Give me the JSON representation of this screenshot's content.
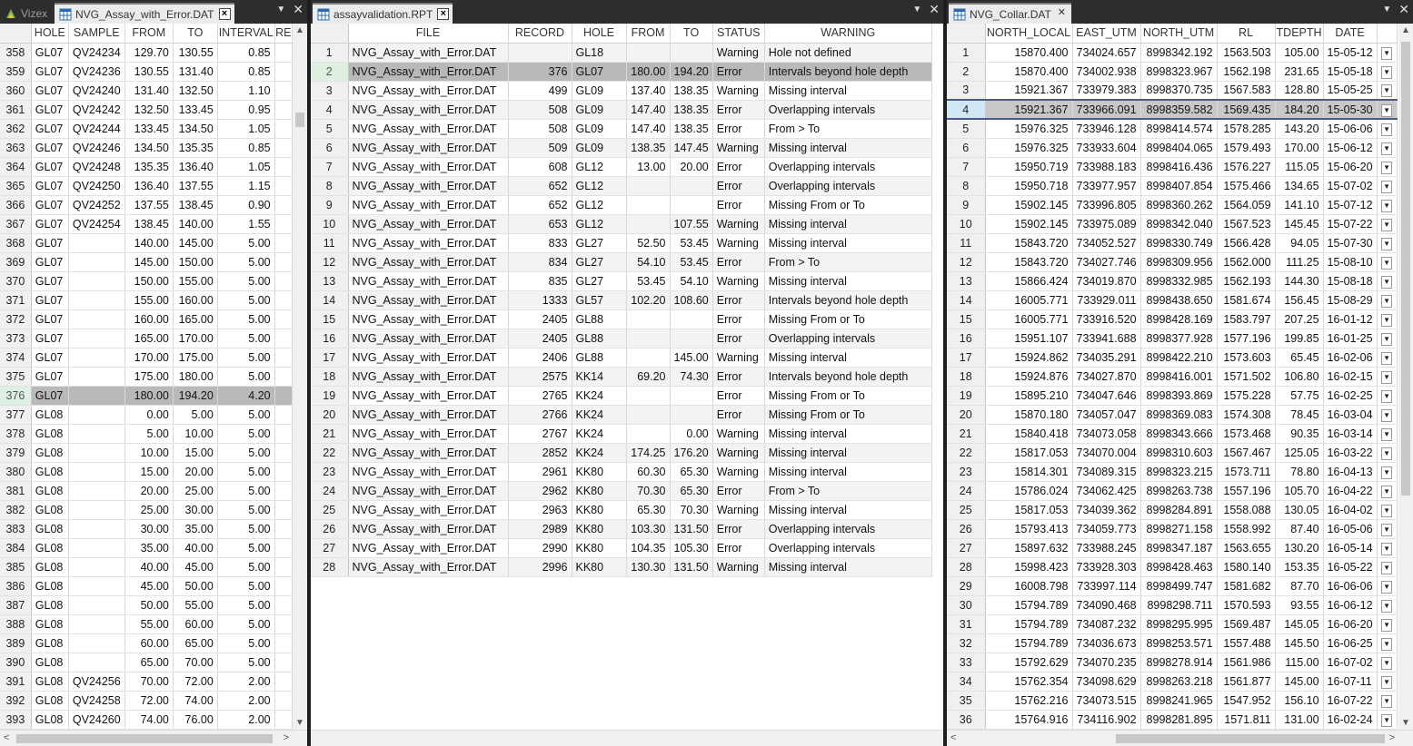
{
  "pane1": {
    "inactive_tab": "Vizex",
    "active_tab": "NVG_Assay_with_Error.DAT",
    "columns": [
      "HOLE",
      "SAMPLE",
      "FROM",
      "TO",
      "INTERVAL",
      "RE"
    ],
    "rows": [
      [
        "358",
        "GL07",
        "QV24234",
        "129.70",
        "130.55",
        "0.85"
      ],
      [
        "359",
        "GL07",
        "QV24236",
        "130.55",
        "131.40",
        "0.85"
      ],
      [
        "360",
        "GL07",
        "QV24240",
        "131.40",
        "132.50",
        "1.10"
      ],
      [
        "361",
        "GL07",
        "QV24242",
        "132.50",
        "133.45",
        "0.95"
      ],
      [
        "362",
        "GL07",
        "QV24244",
        "133.45",
        "134.50",
        "1.05"
      ],
      [
        "363",
        "GL07",
        "QV24246",
        "134.50",
        "135.35",
        "0.85"
      ],
      [
        "364",
        "GL07",
        "QV24248",
        "135.35",
        "136.40",
        "1.05"
      ],
      [
        "365",
        "GL07",
        "QV24250",
        "136.40",
        "137.55",
        "1.15"
      ],
      [
        "366",
        "GL07",
        "QV24252",
        "137.55",
        "138.45",
        "0.90"
      ],
      [
        "367",
        "GL07",
        "QV24254",
        "138.45",
        "140.00",
        "1.55"
      ],
      [
        "368",
        "GL07",
        "",
        "140.00",
        "145.00",
        "5.00"
      ],
      [
        "369",
        "GL07",
        "",
        "145.00",
        "150.00",
        "5.00"
      ],
      [
        "370",
        "GL07",
        "",
        "150.00",
        "155.00",
        "5.00"
      ],
      [
        "371",
        "GL07",
        "",
        "155.00",
        "160.00",
        "5.00"
      ],
      [
        "372",
        "GL07",
        "",
        "160.00",
        "165.00",
        "5.00"
      ],
      [
        "373",
        "GL07",
        "",
        "165.00",
        "170.00",
        "5.00"
      ],
      [
        "374",
        "GL07",
        "",
        "170.00",
        "175.00",
        "5.00"
      ],
      [
        "375",
        "GL07",
        "",
        "175.00",
        "180.00",
        "5.00"
      ],
      [
        "376",
        "GL07",
        "",
        "180.00",
        "194.20",
        "4.20"
      ],
      [
        "377",
        "GL08",
        "",
        "0.00",
        "5.00",
        "5.00"
      ],
      [
        "378",
        "GL08",
        "",
        "5.00",
        "10.00",
        "5.00"
      ],
      [
        "379",
        "GL08",
        "",
        "10.00",
        "15.00",
        "5.00"
      ],
      [
        "380",
        "GL08",
        "",
        "15.00",
        "20.00",
        "5.00"
      ],
      [
        "381",
        "GL08",
        "",
        "20.00",
        "25.00",
        "5.00"
      ],
      [
        "382",
        "GL08",
        "",
        "25.00",
        "30.00",
        "5.00"
      ],
      [
        "383",
        "GL08",
        "",
        "30.00",
        "35.00",
        "5.00"
      ],
      [
        "384",
        "GL08",
        "",
        "35.00",
        "40.00",
        "5.00"
      ],
      [
        "385",
        "GL08",
        "",
        "40.00",
        "45.00",
        "5.00"
      ],
      [
        "386",
        "GL08",
        "",
        "45.00",
        "50.00",
        "5.00"
      ],
      [
        "387",
        "GL08",
        "",
        "50.00",
        "55.00",
        "5.00"
      ],
      [
        "388",
        "GL08",
        "",
        "55.00",
        "60.00",
        "5.00"
      ],
      [
        "389",
        "GL08",
        "",
        "60.00",
        "65.00",
        "5.00"
      ],
      [
        "390",
        "GL08",
        "",
        "65.00",
        "70.00",
        "5.00"
      ],
      [
        "391",
        "GL08",
        "QV24256",
        "70.00",
        "72.00",
        "2.00"
      ],
      [
        "392",
        "GL08",
        "QV24258",
        "72.00",
        "74.00",
        "2.00"
      ],
      [
        "393",
        "GL08",
        "QV24260",
        "74.00",
        "76.00",
        "2.00"
      ]
    ],
    "selected_row": "376"
  },
  "pane2": {
    "active_tab": "assayvalidation.RPT",
    "columns": [
      "FILE",
      "RECORD",
      "HOLE",
      "FROM",
      "TO",
      "STATUS",
      "WARNING"
    ],
    "rows": [
      [
        "1",
        "NVG_Assay_with_Error.DAT",
        "",
        "GL18",
        "",
        "",
        "Warning",
        "Hole not defined"
      ],
      [
        "2",
        "NVG_Assay_with_Error.DAT",
        "376",
        "GL07",
        "180.00",
        "194.20",
        "Error",
        "Intervals beyond hole depth"
      ],
      [
        "3",
        "NVG_Assay_with_Error.DAT",
        "499",
        "GL09",
        "137.40",
        "138.35",
        "Warning",
        "Missing interval"
      ],
      [
        "4",
        "NVG_Assay_with_Error.DAT",
        "508",
        "GL09",
        "147.40",
        "138.35",
        "Error",
        "Overlapping intervals"
      ],
      [
        "5",
        "NVG_Assay_with_Error.DAT",
        "508",
        "GL09",
        "147.40",
        "138.35",
        "Error",
        "From > To"
      ],
      [
        "6",
        "NVG_Assay_with_Error.DAT",
        "509",
        "GL09",
        "138.35",
        "147.45",
        "Warning",
        "Missing interval"
      ],
      [
        "7",
        "NVG_Assay_with_Error.DAT",
        "608",
        "GL12",
        "13.00",
        "20.00",
        "Error",
        "Overlapping intervals"
      ],
      [
        "8",
        "NVG_Assay_with_Error.DAT",
        "652",
        "GL12",
        "",
        "",
        "Error",
        "Overlapping intervals"
      ],
      [
        "9",
        "NVG_Assay_with_Error.DAT",
        "652",
        "GL12",
        "",
        "",
        "Error",
        "Missing From or To"
      ],
      [
        "10",
        "NVG_Assay_with_Error.DAT",
        "653",
        "GL12",
        "",
        "107.55",
        "Warning",
        "Missing interval"
      ],
      [
        "11",
        "NVG_Assay_with_Error.DAT",
        "833",
        "GL27",
        "52.50",
        "53.45",
        "Warning",
        "Missing interval"
      ],
      [
        "12",
        "NVG_Assay_with_Error.DAT",
        "834",
        "GL27",
        "54.10",
        "53.45",
        "Error",
        "From > To"
      ],
      [
        "13",
        "NVG_Assay_with_Error.DAT",
        "835",
        "GL27",
        "53.45",
        "54.10",
        "Warning",
        "Missing interval"
      ],
      [
        "14",
        "NVG_Assay_with_Error.DAT",
        "1333",
        "GL57",
        "102.20",
        "108.60",
        "Error",
        "Intervals beyond hole depth"
      ],
      [
        "15",
        "NVG_Assay_with_Error.DAT",
        "2405",
        "GL88",
        "",
        "",
        "Error",
        "Missing From or To"
      ],
      [
        "16",
        "NVG_Assay_with_Error.DAT",
        "2405",
        "GL88",
        "",
        "",
        "Error",
        "Overlapping intervals"
      ],
      [
        "17",
        "NVG_Assay_with_Error.DAT",
        "2406",
        "GL88",
        "",
        "145.00",
        "Warning",
        "Missing interval"
      ],
      [
        "18",
        "NVG_Assay_with_Error.DAT",
        "2575",
        "KK14",
        "69.20",
        "74.30",
        "Error",
        "Intervals beyond hole depth"
      ],
      [
        "19",
        "NVG_Assay_with_Error.DAT",
        "2765",
        "KK24",
        "",
        "",
        "Error",
        "Missing From or To"
      ],
      [
        "20",
        "NVG_Assay_with_Error.DAT",
        "2766",
        "KK24",
        "",
        "",
        "Error",
        "Missing From or To"
      ],
      [
        "21",
        "NVG_Assay_with_Error.DAT",
        "2767",
        "KK24",
        "",
        "0.00",
        "Warning",
        "Missing interval"
      ],
      [
        "22",
        "NVG_Assay_with_Error.DAT",
        "2852",
        "KK24",
        "174.25",
        "176.20",
        "Warning",
        "Missing interval"
      ],
      [
        "23",
        "NVG_Assay_with_Error.DAT",
        "2961",
        "KK80",
        "60.30",
        "65.30",
        "Warning",
        "Missing interval"
      ],
      [
        "24",
        "NVG_Assay_with_Error.DAT",
        "2962",
        "KK80",
        "70.30",
        "65.30",
        "Error",
        "From > To"
      ],
      [
        "25",
        "NVG_Assay_with_Error.DAT",
        "2963",
        "KK80",
        "65.30",
        "70.30",
        "Warning",
        "Missing interval"
      ],
      [
        "26",
        "NVG_Assay_with_Error.DAT",
        "2989",
        "KK80",
        "103.30",
        "131.50",
        "Error",
        "Overlapping intervals"
      ],
      [
        "27",
        "NVG_Assay_with_Error.DAT",
        "2990",
        "KK80",
        "104.35",
        "105.30",
        "Error",
        "Overlapping intervals"
      ],
      [
        "28",
        "NVG_Assay_with_Error.DAT",
        "2996",
        "KK80",
        "130.30",
        "131.50",
        "Warning",
        "Missing interval"
      ]
    ],
    "selected_row": "2"
  },
  "pane3": {
    "active_tab": "NVG_Collar.DAT",
    "columns": [
      "NORTH_LOCAL",
      "EAST_UTM",
      "NORTH_UTM",
      "RL",
      "TDEPTH",
      "DATE"
    ],
    "rows": [
      [
        "1",
        "15870.400",
        "734024.657",
        "8998342.192",
        "1563.503",
        "105.00",
        "15-05-12"
      ],
      [
        "2",
        "15870.400",
        "734002.938",
        "8998323.967",
        "1562.198",
        "231.65",
        "15-05-18"
      ],
      [
        "3",
        "15921.367",
        "733979.383",
        "8998370.735",
        "1567.583",
        "128.80",
        "15-05-25"
      ],
      [
        "4",
        "15921.367",
        "733966.091",
        "8998359.582",
        "1569.435",
        "184.20",
        "15-05-30"
      ],
      [
        "5",
        "15976.325",
        "733946.128",
        "8998414.574",
        "1578.285",
        "143.20",
        "15-06-06"
      ],
      [
        "6",
        "15976.325",
        "733933.604",
        "8998404.065",
        "1579.493",
        "170.00",
        "15-06-12"
      ],
      [
        "7",
        "15950.719",
        "733988.183",
        "8998416.436",
        "1576.227",
        "115.05",
        "15-06-20"
      ],
      [
        "8",
        "15950.718",
        "733977.957",
        "8998407.854",
        "1575.466",
        "134.65",
        "15-07-02"
      ],
      [
        "9",
        "15902.145",
        "733996.805",
        "8998360.262",
        "1564.059",
        "141.10",
        "15-07-12"
      ],
      [
        "10",
        "15902.145",
        "733975.089",
        "8998342.040",
        "1567.523",
        "145.45",
        "15-07-22"
      ],
      [
        "11",
        "15843.720",
        "734052.527",
        "8998330.749",
        "1566.428",
        "94.05",
        "15-07-30"
      ],
      [
        "12",
        "15843.720",
        "734027.746",
        "8998309.956",
        "1562.000",
        "111.25",
        "15-08-10"
      ],
      [
        "13",
        "15866.424",
        "734019.870",
        "8998332.985",
        "1562.193",
        "144.30",
        "15-08-18"
      ],
      [
        "14",
        "16005.771",
        "733929.011",
        "8998438.650",
        "1581.674",
        "156.45",
        "15-08-29"
      ],
      [
        "15",
        "16005.771",
        "733916.520",
        "8998428.169",
        "1583.797",
        "207.25",
        "16-01-12"
      ],
      [
        "16",
        "15951.107",
        "733941.688",
        "8998377.928",
        "1577.196",
        "199.85",
        "16-01-25"
      ],
      [
        "17",
        "15924.862",
        "734035.291",
        "8998422.210",
        "1573.603",
        "65.45",
        "16-02-06"
      ],
      [
        "18",
        "15924.876",
        "734027.870",
        "8998416.001",
        "1571.502",
        "106.80",
        "16-02-15"
      ],
      [
        "19",
        "15895.210",
        "734047.646",
        "8998393.869",
        "1575.228",
        "57.75",
        "16-02-25"
      ],
      [
        "20",
        "15870.180",
        "734057.047",
        "8998369.083",
        "1574.308",
        "78.45",
        "16-03-04"
      ],
      [
        "21",
        "15840.418",
        "734073.058",
        "8998343.666",
        "1573.468",
        "90.35",
        "16-03-14"
      ],
      [
        "22",
        "15817.053",
        "734070.004",
        "8998310.603",
        "1567.467",
        "125.05",
        "16-03-22"
      ],
      [
        "23",
        "15814.301",
        "734089.315",
        "8998323.215",
        "1573.711",
        "78.80",
        "16-04-13"
      ],
      [
        "24",
        "15786.024",
        "734062.425",
        "8998263.738",
        "1557.196",
        "105.70",
        "16-04-22"
      ],
      [
        "25",
        "15817.053",
        "734039.362",
        "8998284.891",
        "1558.088",
        "130.05",
        "16-04-02"
      ],
      [
        "26",
        "15793.413",
        "734059.773",
        "8998271.158",
        "1558.992",
        "87.40",
        "16-05-06"
      ],
      [
        "27",
        "15897.632",
        "733988.245",
        "8998347.187",
        "1563.655",
        "130.20",
        "16-05-14"
      ],
      [
        "28",
        "15998.423",
        "733928.303",
        "8998428.463",
        "1580.140",
        "153.35",
        "16-05-22"
      ],
      [
        "29",
        "16008.798",
        "733997.114",
        "8998499.747",
        "1581.682",
        "87.70",
        "16-06-06"
      ],
      [
        "30",
        "15794.789",
        "734090.468",
        "8998298.711",
        "1570.593",
        "93.55",
        "16-06-12"
      ],
      [
        "31",
        "15794.789",
        "734087.232",
        "8998295.995",
        "1569.487",
        "145.05",
        "16-06-20"
      ],
      [
        "32",
        "15794.789",
        "734036.673",
        "8998253.571",
        "1557.488",
        "145.50",
        "16-06-25"
      ],
      [
        "33",
        "15792.629",
        "734070.235",
        "8998278.914",
        "1561.986",
        "115.00",
        "16-07-02"
      ],
      [
        "34",
        "15762.354",
        "734098.629",
        "8998263.218",
        "1561.877",
        "145.00",
        "16-07-11"
      ],
      [
        "35",
        "15762.216",
        "734073.515",
        "8998241.965",
        "1547.952",
        "156.10",
        "16-07-22"
      ],
      [
        "36",
        "15764.916",
        "734116.902",
        "8998281.895",
        "1571.811",
        "131.00",
        "16-02-24"
      ]
    ],
    "selected_row": "4"
  }
}
